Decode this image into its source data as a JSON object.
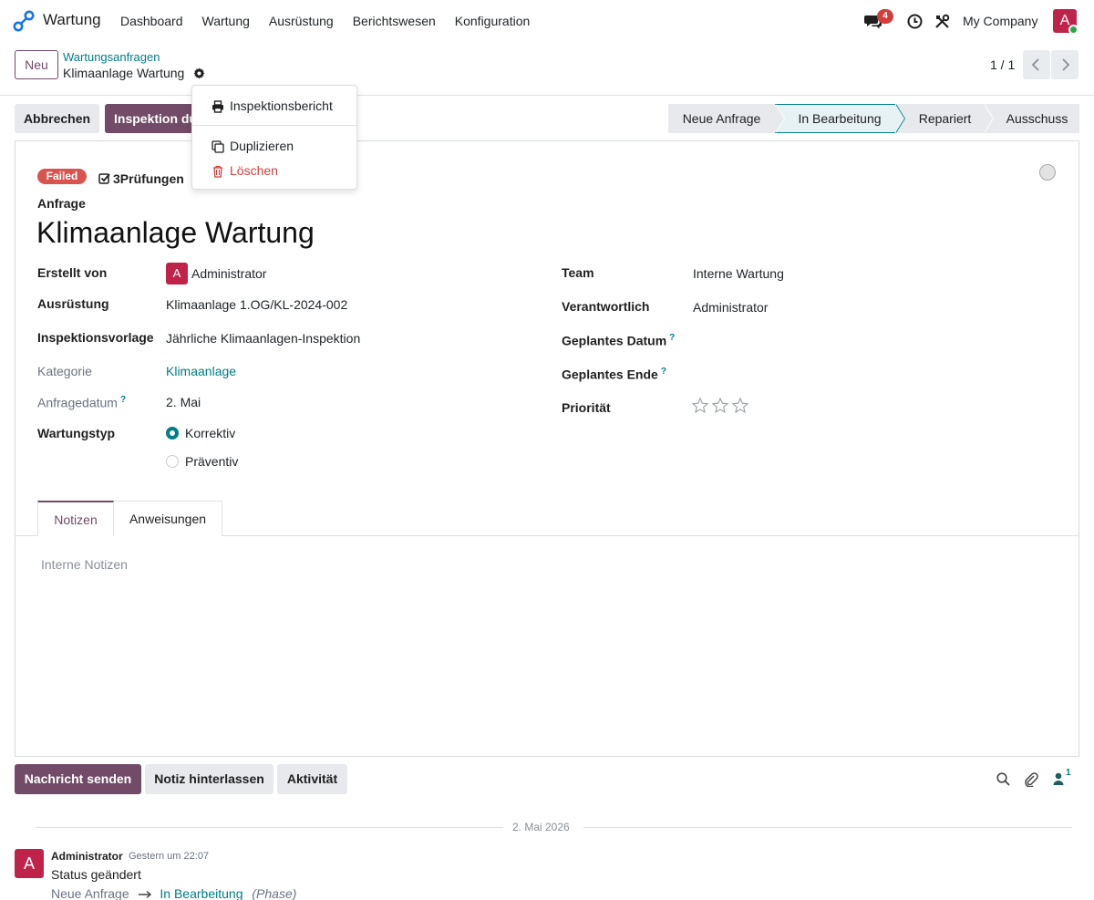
{
  "navbar": {
    "app_name": "Wartung",
    "menu": [
      "Dashboard",
      "Wartung",
      "Ausrüstung",
      "Berichtswesen",
      "Konfiguration"
    ],
    "chat_badge": "4",
    "company": "My Company",
    "user_initial": "A"
  },
  "control": {
    "new_button": "Neu",
    "breadcrumb_parent": "Wartungsanfragen",
    "breadcrumb_current": "Klimaanlage Wartung",
    "pager": "1 / 1"
  },
  "actions": {
    "cancel": "Abbrechen",
    "inspect": "Inspektion durchführen"
  },
  "statusbar": {
    "stages": [
      "Neue Anfrage",
      "In Bearbeitung",
      "Repariert",
      "Ausschuss"
    ],
    "active": "In Bearbeitung"
  },
  "gear_menu": {
    "items": [
      {
        "label": "Inspektionsbericht",
        "icon": "print-icon"
      },
      {
        "label": "Duplizieren",
        "icon": "copy-icon"
      },
      {
        "label": "Löschen",
        "icon": "trash-icon"
      }
    ]
  },
  "form": {
    "status_badge": "Failed",
    "checks_count": "3",
    "checks_label": "Prüfungen",
    "request_label": "Anfrage",
    "title": "Klimaanlage Wartung",
    "left": [
      {
        "label": "Erstellt von",
        "value": "Administrator",
        "avatar": "A"
      },
      {
        "label": "Ausrüstung",
        "value": "Klimaanlage 1.OG/KL-2024-002"
      },
      {
        "label": "Inspektionsvorlage",
        "value": "Jährliche Klimaanlagen-Inspektion"
      },
      {
        "label": "Kategorie",
        "value": "Klimaanlage"
      },
      {
        "label": "Anfragedatum",
        "value": "2. Mai",
        "help": "?"
      },
      {
        "label": "Wartungstyp",
        "options": [
          "Korrektiv",
          "Präventiv"
        ],
        "selected": "Korrektiv"
      }
    ],
    "right": [
      {
        "label": "Team",
        "value": "Interne Wartung"
      },
      {
        "label": "Verantwortlich",
        "value": "Administrator"
      },
      {
        "label": "Geplantes Datum",
        "value": "",
        "help": "?"
      },
      {
        "label": "Geplantes Ende",
        "value": "",
        "help": "?"
      },
      {
        "label": "Priorität",
        "stars": 0,
        "max_stars": 3
      }
    ]
  },
  "tabs": {
    "items": [
      "Notizen",
      "Anweisungen"
    ],
    "active": "Notizen",
    "notes_placeholder": "Interne Notizen"
  },
  "chatter": {
    "send": "Nachricht senden",
    "note": "Notiz hinterlassen",
    "activity": "Aktivität",
    "followers": "1",
    "date_separator": "2. Mai 2026",
    "message": {
      "avatar": "A",
      "author": "Administrator",
      "time": "Gestern um 22:07",
      "body": "Status geändert",
      "from": "Neue Anfrage",
      "to": "In Bearbeitung",
      "field": "(Phase)"
    }
  },
  "colors": {
    "brand": "#714b67",
    "accent": "#017e84",
    "danger": "#d23f3a",
    "avatar": "#c0234a"
  }
}
